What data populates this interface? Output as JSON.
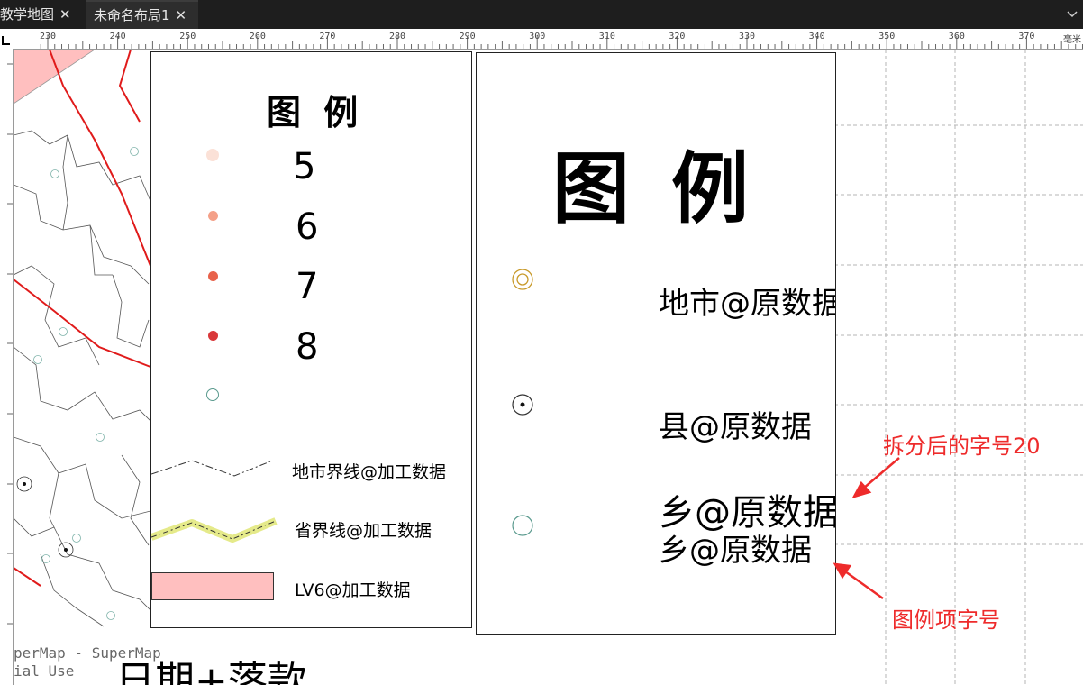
{
  "tabs": [
    {
      "label": "教学地图",
      "close": "✕"
    },
    {
      "label": "未命名布局1",
      "close": "✕"
    }
  ],
  "tab_dropdown_icon": "chevron-down-icon",
  "ruler": {
    "labels": [
      "230",
      "240",
      "250",
      "260",
      "270",
      "280",
      "290",
      "300",
      "310",
      "320",
      "330",
      "340",
      "350",
      "360",
      "370"
    ],
    "unit": "毫米"
  },
  "legend_small": {
    "title": "图  例",
    "items": [
      {
        "label": "5",
        "color": "#fbe1d7"
      },
      {
        "label": "6",
        "color": "#f4a088"
      },
      {
        "label": "7",
        "color": "#e8624b"
      },
      {
        "label": "8",
        "color": "#d9383a"
      },
      {
        "label": "",
        "color": "#5a9a8e"
      }
    ],
    "lines": [
      {
        "label": "地市界线@加工数据"
      },
      {
        "label": "省界线@加工数据"
      },
      {
        "label": "LV6@加工数据",
        "color": "#ffbfbf"
      }
    ]
  },
  "legend_large": {
    "title": "图  例",
    "items": [
      {
        "label": "地市@原数据",
        "icon": "concentric-circle-icon",
        "color": "#c89a2a"
      },
      {
        "label": "县@原数据",
        "icon": "dot-circle-icon",
        "color": "#333333"
      },
      {
        "label": "乡@原数据",
        "icon": "circle-icon",
        "color": "#5a9a8e"
      }
    ],
    "sub_label": "乡@原数据"
  },
  "annotations": {
    "split_font": "拆分后的字号20",
    "item_font": "图例项字号",
    "color": "#ee2b2b"
  },
  "watermark": {
    "line1": "perMap - SuperMap",
    "line2": "ial Use"
  },
  "date_sign": "日期+落款"
}
